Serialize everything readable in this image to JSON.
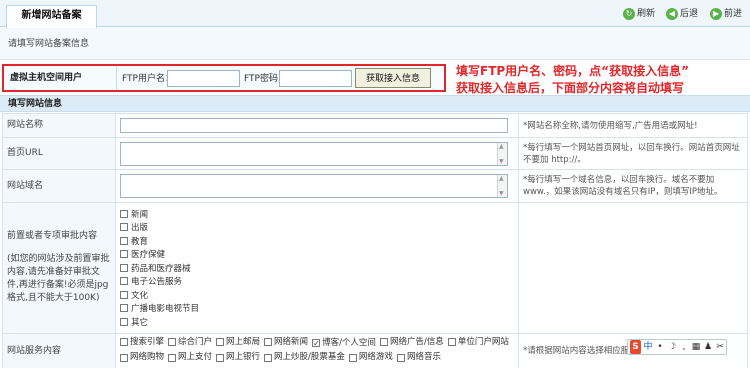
{
  "tab": {
    "title": "新增网站备案"
  },
  "toolbar": {
    "refresh": "刷新",
    "back": "后退",
    "forward": "前进"
  },
  "info_line": "请填写网站备案信息",
  "ftp": {
    "section_label": "虚拟主机空间用户",
    "user_label": "FTP用户名：",
    "user_value": "",
    "password_label": "FTP密码：",
    "password_value": "",
    "fetch_button": "获取接入信息"
  },
  "annotation": {
    "line1": "填写FTP用户名、密码，点“获取接入信息”",
    "line2": "获取接入信息后，下面部分内容将自动填写"
  },
  "section_title": "填写网站信息",
  "fields": {
    "site_name": {
      "label": "网站名称",
      "value": "",
      "tip": "*网站名称全称,请勿使用缩写,广告用语或网址!"
    },
    "home_url": {
      "label": "首页URL",
      "value": "",
      "tip": "*每行填写一个网站首页网址，以回车换行。网站首页网址不要加 http://。"
    },
    "domain": {
      "label": "网站域名",
      "value": "",
      "tip": "*每行填写一个域名信息，以回车换行。域名不要加www.，如果该网站没有域名只有IP，则填写IP地址。"
    }
  },
  "approval": {
    "label": "前置或者专项审批内容",
    "note": "(如您的网站涉及前置审批内容,请先准备好审批文件,再进行备案!必须是jpg格式,且不能大于100K)",
    "options": [
      {
        "label": "新闻",
        "checked": false
      },
      {
        "label": "出版",
        "checked": false
      },
      {
        "label": "教育",
        "checked": false
      },
      {
        "label": "医疗保健",
        "checked": false
      },
      {
        "label": "药品和医疗器械",
        "checked": false
      },
      {
        "label": "电子公告服务",
        "checked": false
      },
      {
        "label": "文化",
        "checked": false
      },
      {
        "label": "广播电影电视节目",
        "checked": false
      },
      {
        "label": "其它",
        "checked": false
      }
    ]
  },
  "services": {
    "label": "网站服务内容",
    "tip": "*请根据网站内容选择相应服务内容选项",
    "options": [
      {
        "label": "搜索引擎",
        "checked": false
      },
      {
        "label": "综合门户",
        "checked": false
      },
      {
        "label": "网上邮局",
        "checked": false
      },
      {
        "label": "网络新闻",
        "checked": false
      },
      {
        "label": "博客/个人空间",
        "checked": true
      },
      {
        "label": "网络广告/信息",
        "checked": false
      },
      {
        "label": "单位门户网站",
        "checked": false
      },
      {
        "label": "网络购物",
        "checked": false
      },
      {
        "label": "网上支付",
        "checked": false
      },
      {
        "label": "网上银行",
        "checked": false
      },
      {
        "label": "网上炒股/股票基金",
        "checked": false
      },
      {
        "label": "网络游戏",
        "checked": false
      },
      {
        "label": "网络音乐",
        "checked": false
      }
    ]
  },
  "ime": {
    "logo": "S",
    "mode": "中",
    "punct": "•",
    "moon": "☽",
    "dot": ",",
    "keyboard": "▦",
    "user": "♟",
    "tools": "✂"
  },
  "colors": {
    "accent_red": "#e0282c",
    "header_blue": "#dbeaf5"
  }
}
